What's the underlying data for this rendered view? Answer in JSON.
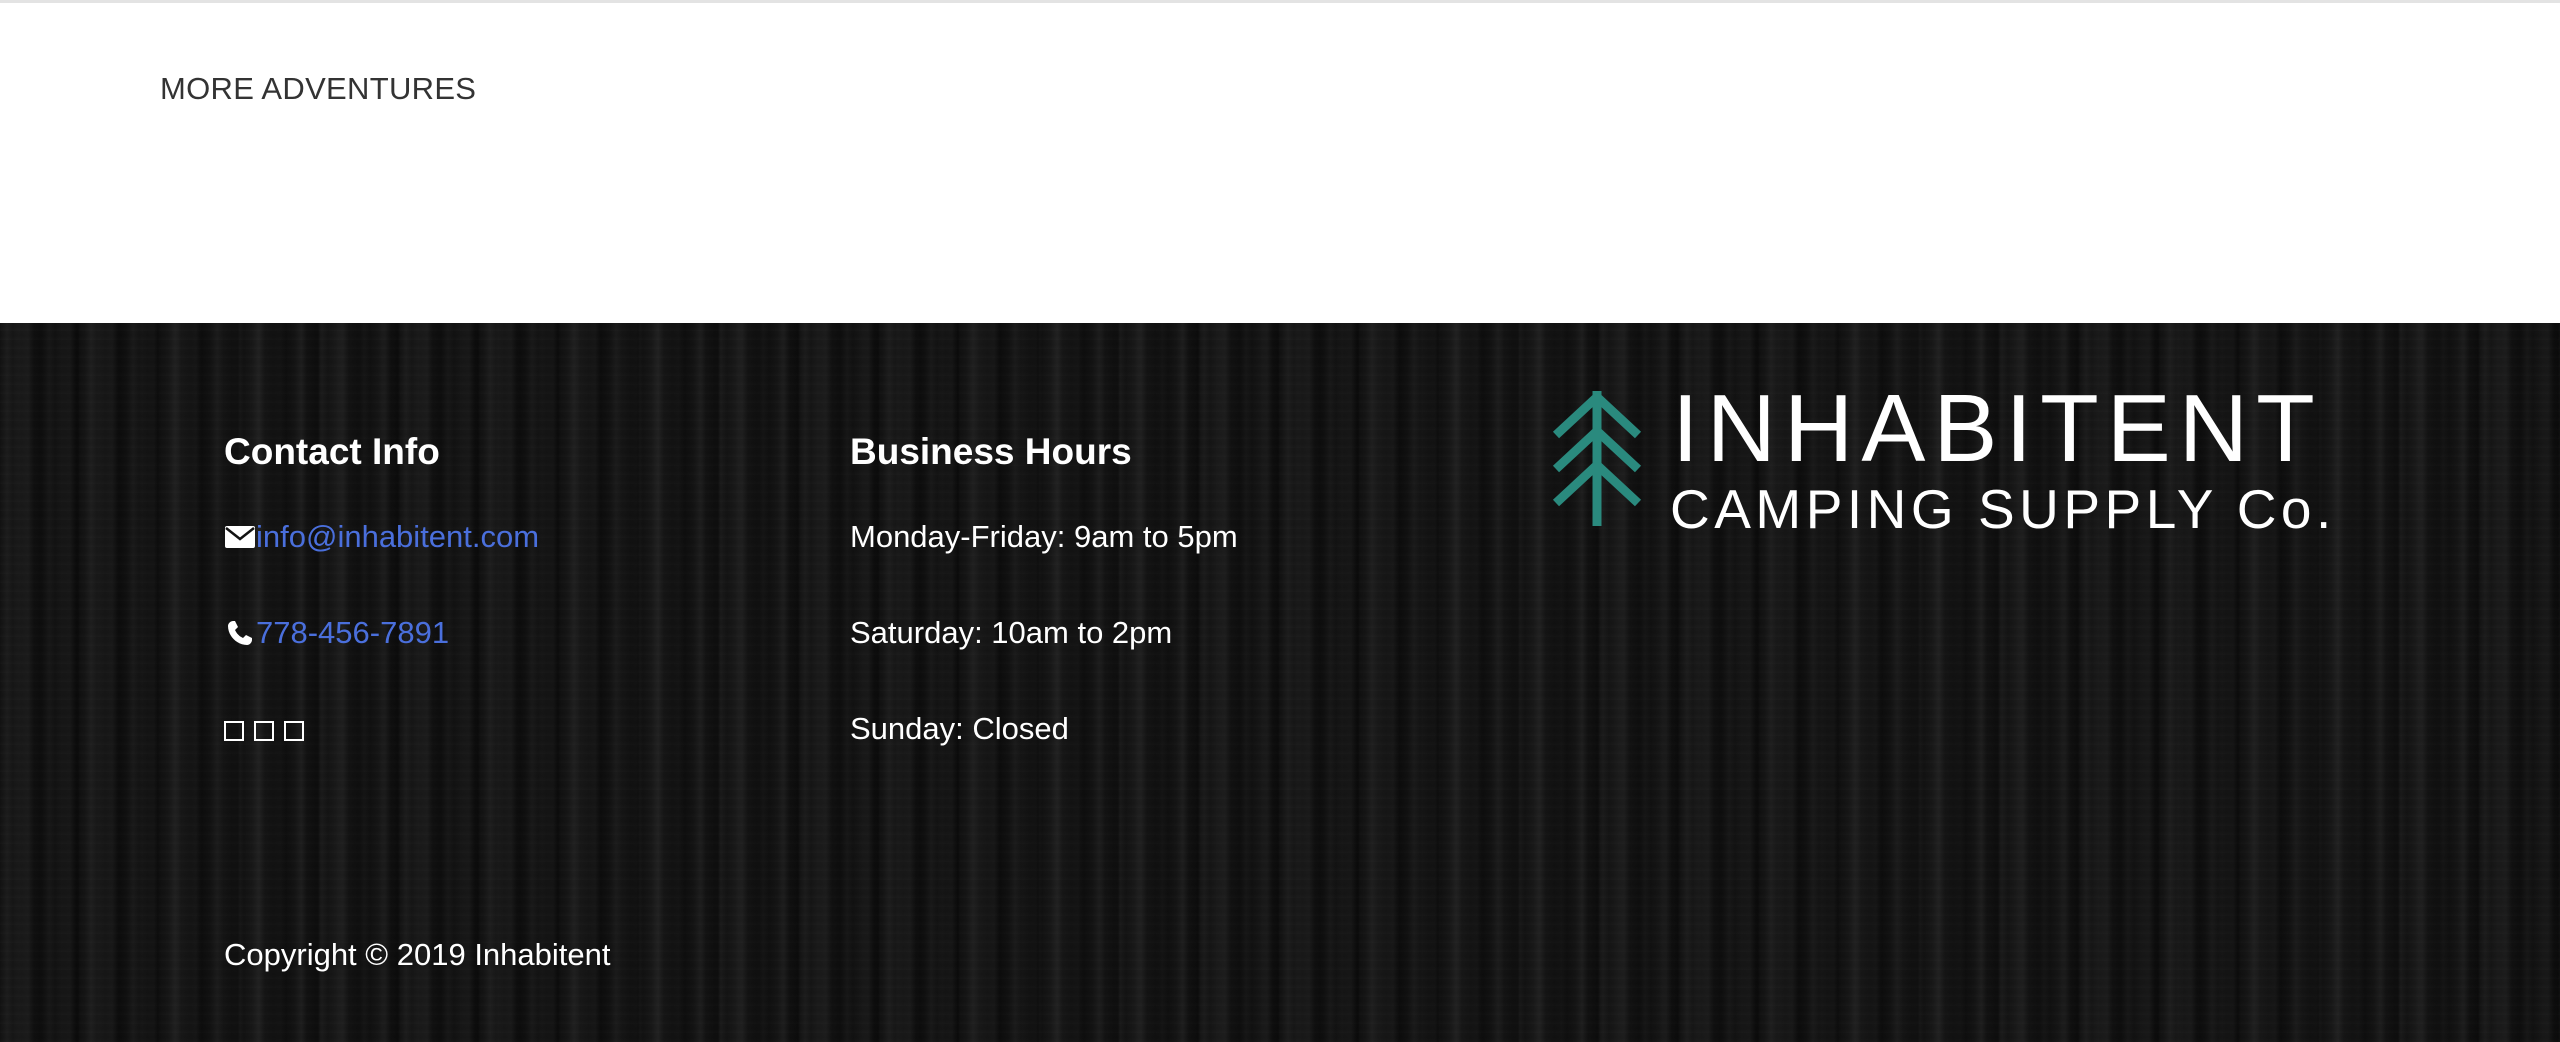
{
  "top_section": {
    "more_adventures_label": "MORE ADVENTURES"
  },
  "footer": {
    "contact": {
      "heading": "Contact Info",
      "email": "info@inhabitent.com",
      "phone": "778-456-7891",
      "email_icon": "envelope-icon",
      "phone_icon": "phone-icon",
      "social_icons": [
        "social-icon-1",
        "social-icon-2",
        "social-icon-3"
      ]
    },
    "hours": {
      "heading": "Business Hours",
      "lines": [
        "Monday-Friday: 9am to 5pm",
        "Saturday: 10am to 2pm",
        "Sunday: Closed"
      ]
    },
    "logo": {
      "title": "INHABITENT",
      "subtitle": "CAMPING SUPPLY Co.",
      "icon": "pine-tree-icon"
    },
    "copyright": "Copyright © 2019 Inhabitent"
  },
  "colors": {
    "link": "#4a6fdc",
    "logo_accent": "#2a8a7e",
    "footer_bg": "#121212",
    "heading_text": "#333333"
  }
}
